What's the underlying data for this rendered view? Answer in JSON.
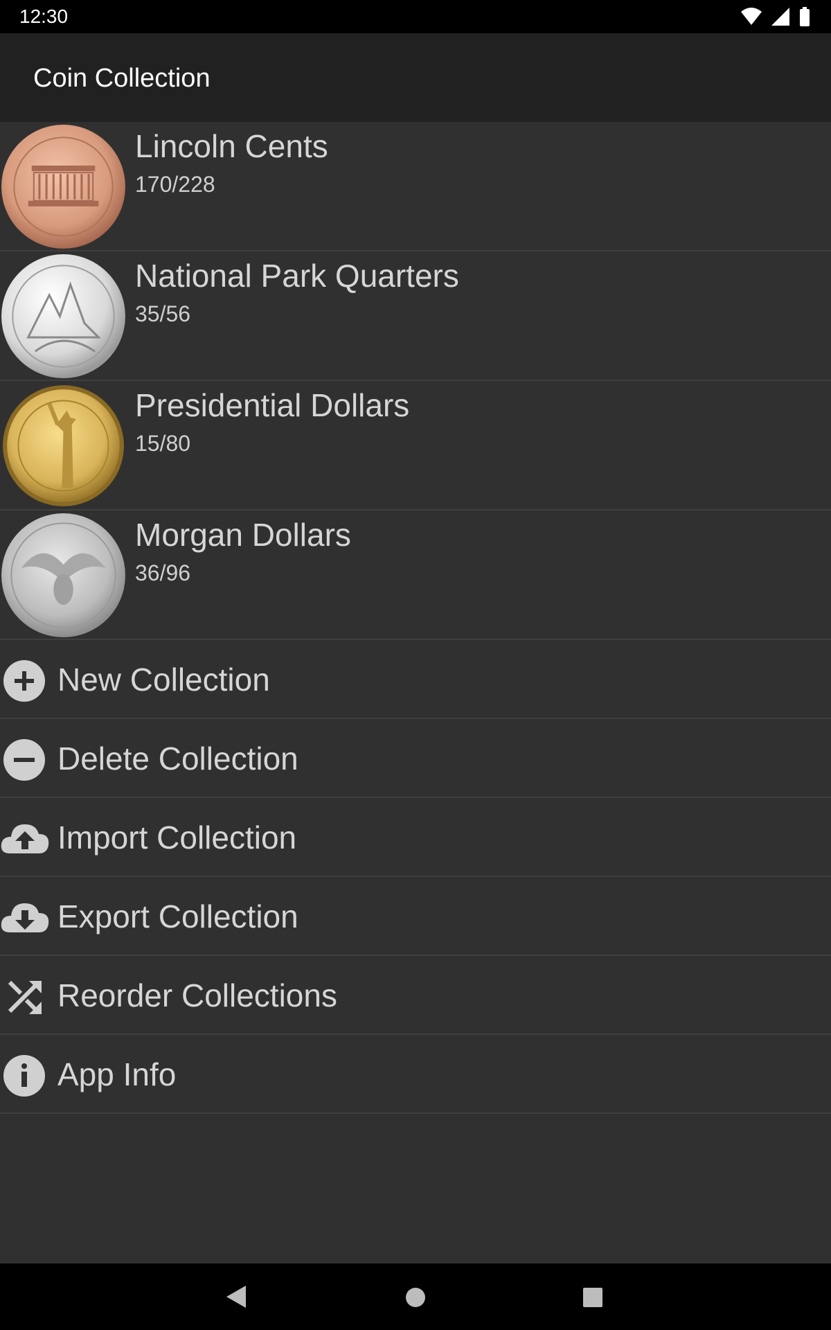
{
  "status": {
    "time": "12:30"
  },
  "app": {
    "title": "Coin Collection"
  },
  "collections": [
    {
      "name": "Lincoln Cents",
      "count": "170/228"
    },
    {
      "name": "National Park Quarters",
      "count": "35/56"
    },
    {
      "name": "Presidential Dollars",
      "count": "15/80"
    },
    {
      "name": "Morgan Dollars",
      "count": "36/96"
    }
  ],
  "actions": [
    {
      "label": "New Collection",
      "icon": "plus-circle-icon"
    },
    {
      "label": "Delete Collection",
      "icon": "minus-circle-icon"
    },
    {
      "label": "Import Collection",
      "icon": "cloud-upload-icon"
    },
    {
      "label": "Export Collection",
      "icon": "cloud-download-icon"
    },
    {
      "label": "Reorder Collections",
      "icon": "shuffle-icon"
    },
    {
      "label": "App Info",
      "icon": "info-icon"
    }
  ],
  "colors": {
    "background": "#303030",
    "app_bar": "#212121",
    "status_bar": "#000000",
    "divider": "#3f3f3f"
  }
}
